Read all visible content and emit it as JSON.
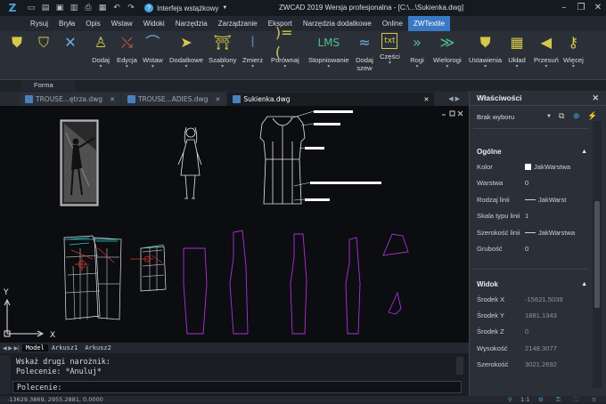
{
  "app": {
    "title": "ZWCAD 2019 Wersja profesjonalna - [C:\\...\\Sukienka.dwg]",
    "logo": "zw-logo",
    "workspace": "Interfejs wstążkowy"
  },
  "menubar": {
    "items": [
      "Rysuj",
      "Bryła",
      "Opis",
      "Wstaw",
      "Widoki",
      "Narzędzia",
      "Zarządzanie",
      "Eksport",
      "Narzędzia dodatkowe",
      "Online",
      "ZWTextile"
    ],
    "active": "ZWTextile"
  },
  "ribbon": {
    "group_label": "Forma",
    "buttons": [
      {
        "icon": "shirt-icon",
        "label": "",
        "color": "#d6c84a"
      },
      {
        "icon": "shirt-add-icon",
        "label": "",
        "color": "#d6c84a"
      },
      {
        "icon": "shirt-delete-icon",
        "label": "",
        "color": "#d6c84a"
      },
      {
        "icon": "dress-icon",
        "label": "Dodaj",
        "color": "#d6c84a"
      },
      {
        "icon": "edit-curve-icon",
        "label": "Edycja",
        "color": "#d6c84a"
      },
      {
        "icon": "insert-curve-icon",
        "label": "Wstaw",
        "color": "#d6c84a"
      },
      {
        "icon": "arrow-right-icon",
        "label": "Dodatkowe",
        "color": "#d6c84a"
      },
      {
        "icon": "template-icon",
        "label": "Szablony",
        "color": "#d6c84a"
      },
      {
        "icon": "measure-icon",
        "label": "Zmierz",
        "color": "#d6c84a"
      },
      {
        "icon": "compare-icon",
        "label": "Porównaj",
        "color": "#d6c84a"
      },
      {
        "icon": "grading-icon",
        "label": "Stopniowanie",
        "color": "#d6c84a"
      },
      {
        "icon": "seam-icon",
        "label": "Dodaj szew",
        "color": "#d6c84a"
      },
      {
        "icon": "parts-txt-icon",
        "label": "Części",
        "color": "#d6c84a"
      },
      {
        "icon": "corners-icon",
        "label": "Rogi",
        "color": "#4fc08d"
      },
      {
        "icon": "multicorners-icon",
        "label": "Wielorogi",
        "color": "#4fc08d"
      },
      {
        "icon": "settings-shirt-icon",
        "label": "Ustawienia",
        "color": "#d6c84a"
      },
      {
        "icon": "layout-icon",
        "label": "Układ",
        "color": "#d6c84a"
      },
      {
        "icon": "shift-icon",
        "label": "Przesuń",
        "color": "#d6c84a"
      },
      {
        "icon": "more-key-icon",
        "label": "Więcej",
        "color": "#d6c84a"
      }
    ]
  },
  "doc_tabs": [
    {
      "label": "TROUSE...ętrza.dwg",
      "active": false
    },
    {
      "label": "TROUSE...ADIES.dwg",
      "active": false
    },
    {
      "label": "Sukienka.dwg",
      "active": true
    }
  ],
  "layout_tabs": [
    "Model",
    "Arkusz1",
    "Arkusz2"
  ],
  "command": {
    "lines": [
      "Wskaż drugi narożnik:",
      "Polecenie: *Anuluj*"
    ],
    "prompt": "Polecenie:"
  },
  "status": {
    "coords": "-13629.3869, 2955.2881, 0.0000",
    "scale": "1:1"
  },
  "properties": {
    "title": "Właściwości",
    "selection": "Brak wyboru",
    "general_header": "Ogólne",
    "general": [
      {
        "key": "Kolor",
        "value": "JakWarstwa"
      },
      {
        "key": "Warstwa",
        "value": "0"
      },
      {
        "key": "Rodzaj linii",
        "value": "JakWarst"
      },
      {
        "key": "Skala typu linii",
        "value": "1"
      },
      {
        "key": "Szerokość linii",
        "value": "JakWarstwa"
      },
      {
        "key": "Grubość",
        "value": "0"
      }
    ],
    "view_header": "Widok",
    "view": [
      {
        "key": "Środek X",
        "value": "-15621.5039"
      },
      {
        "key": "Środek Y",
        "value": "1881.1343"
      },
      {
        "key": "Środek Z",
        "value": "0"
      },
      {
        "key": "Wysokość",
        "value": "2148.3077"
      },
      {
        "key": "Szerokość",
        "value": "3021.2692"
      }
    ]
  },
  "canvas": {
    "ucs_x": "X",
    "ucs_y": "Y"
  },
  "colors": {
    "accent": "#3a79c4",
    "pattern_magenta": "#b030d8",
    "pattern_cyan": "#38c8c8",
    "pattern_red": "#e03030"
  }
}
